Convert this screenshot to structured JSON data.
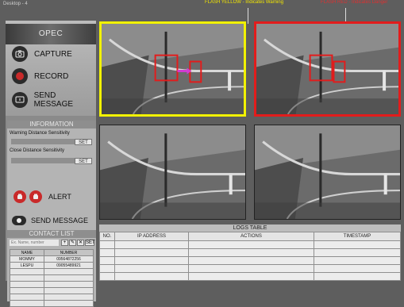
{
  "window": {
    "title": "Desktop - 4"
  },
  "annotations": {
    "yellow": "FLASH YELLOW - Indicates Warning",
    "red": "FLASH RED - Indicates Danger"
  },
  "colors": {
    "warning": "#f2f200",
    "danger": "#e21c1c",
    "alert_icon": "#c92a2a"
  },
  "sidebar": {
    "app_title": "OPEC",
    "actions": [
      {
        "label": "CAPTURE",
        "icon": "camera-icon"
      },
      {
        "label": "RECORD",
        "icon": "record-icon"
      },
      {
        "label": "SEND MESSAGE",
        "icon": "message-icon"
      }
    ],
    "information": {
      "title": "INFORMATION",
      "warning_label": "Warning Distance Sensitivity",
      "warning_set": "SET",
      "close_label": "Close Distance Sensitivity",
      "close_set": "SET",
      "alert_label": "ALERT",
      "send_label": "SEND MESSAGE"
    },
    "contact_list": {
      "title": "CONTACT LIST",
      "search_placeholder": "Ex. Name, number",
      "buttons": [
        "+",
        "✎",
        "✕"
      ],
      "set_label": "SET",
      "columns": [
        "NAME",
        "NUMBER"
      ],
      "rows": [
        [
          "MOMMY",
          "09564872256"
        ],
        [
          "LESPU",
          "09055489921"
        ]
      ]
    }
  },
  "feeds": [
    {
      "name": "camera-feed-1",
      "status": "warning"
    },
    {
      "name": "camera-feed-2",
      "status": "danger"
    },
    {
      "name": "camera-feed-3",
      "status": "normal"
    },
    {
      "name": "camera-feed-4",
      "status": "normal"
    }
  ],
  "logs": {
    "title": "LOGS TABLE",
    "columns": [
      "NO.",
      "IP ADDRESS",
      "ACTIONS",
      "TIMESTAMP"
    ],
    "rows": 5
  }
}
